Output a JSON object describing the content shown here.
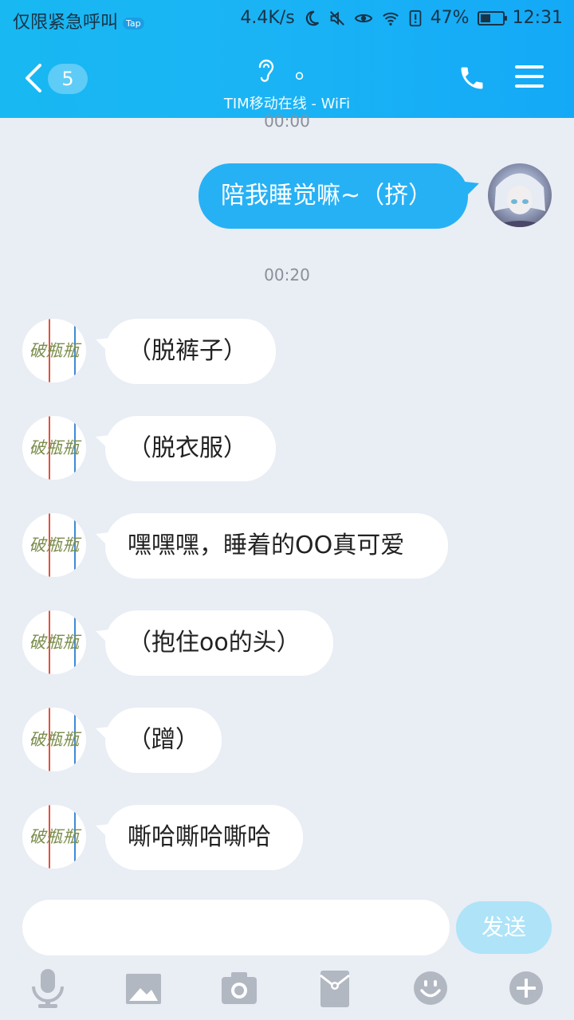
{
  "status_bar": {
    "carrier": "仅限紧急呼叫",
    "tap_badge": "Tap",
    "speed": "4.4K/s",
    "battery": "47%",
    "time": "12:31"
  },
  "header": {
    "unread_count": "5",
    "contact_name": "。",
    "status": "TIM移动在线 - WiFi"
  },
  "chat": {
    "partial_timestamp": "00:00",
    "outgoing": [
      {
        "text": "陪我睡觉嘛~（挤）"
      }
    ],
    "timestamp": "00:20",
    "incoming": [
      {
        "text": "（脱裤子）"
      },
      {
        "text": "（脱衣服）"
      },
      {
        "text": "嘿嘿嘿，睡着的OO真可爱"
      },
      {
        "text": "（抱住oo的头）"
      },
      {
        "text": "（蹭）"
      },
      {
        "text": "嘶哈嘶哈嘶哈"
      }
    ],
    "incoming_avatar_text": "破瓶瓶"
  },
  "composer": {
    "send_label": "发送"
  },
  "toolbar_icons": [
    "microphone-icon",
    "image-icon",
    "camera-icon",
    "red-packet-icon",
    "emoji-icon",
    "plus-icon"
  ],
  "colors": {
    "header": "#18b8f2",
    "outgoing_bubble": "#27b1f5",
    "send_disabled": "#aee3f8",
    "background": "#e9edf4"
  }
}
